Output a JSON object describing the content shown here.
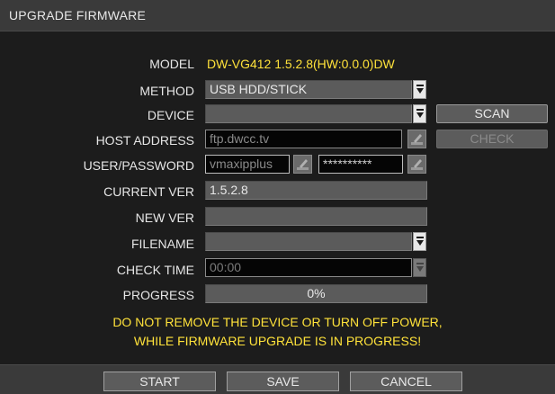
{
  "window": {
    "title": "UPGRADE FIRMWARE"
  },
  "form": {
    "model": {
      "label": "MODEL",
      "value": "DW-VG412 1.5.2.8(HW:0.0.0)DW"
    },
    "method": {
      "label": "METHOD",
      "value": "USB HDD/STICK"
    },
    "device": {
      "label": "DEVICE",
      "value": ""
    },
    "host_address": {
      "label": "HOST ADDRESS",
      "value": "ftp.dwcc.tv"
    },
    "user_password": {
      "label": "USER/PASSWORD",
      "user": "vmaxipplus",
      "password": "**********"
    },
    "current_ver": {
      "label": "CURRENT VER",
      "value": "1.5.2.8"
    },
    "new_ver": {
      "label": "NEW VER",
      "value": ""
    },
    "filename": {
      "label": "FILENAME",
      "value": ""
    },
    "check_time": {
      "label": "CHECK TIME",
      "value": "00:00"
    },
    "progress": {
      "label": "PROGRESS",
      "value": "0%",
      "fraction": 0
    }
  },
  "buttons": {
    "scan": "SCAN",
    "check": "CHECK"
  },
  "warning": {
    "line1": "DO NOT REMOVE THE DEVICE OR TURN OFF POWER,",
    "line2": "WHILE FIRMWARE UPGRADE IS IN PROGRESS!"
  },
  "footer": {
    "start": "START",
    "save": "SAVE",
    "cancel": "CANCEL"
  },
  "colors": {
    "accent_yellow": "#ffe23a",
    "panel_bg": "#1c1c1c",
    "field_bg": "#5b5b5b"
  },
  "icons": {
    "dropdown": "dropdown-arrow-icon",
    "edit": "pencil-edit-icon"
  }
}
